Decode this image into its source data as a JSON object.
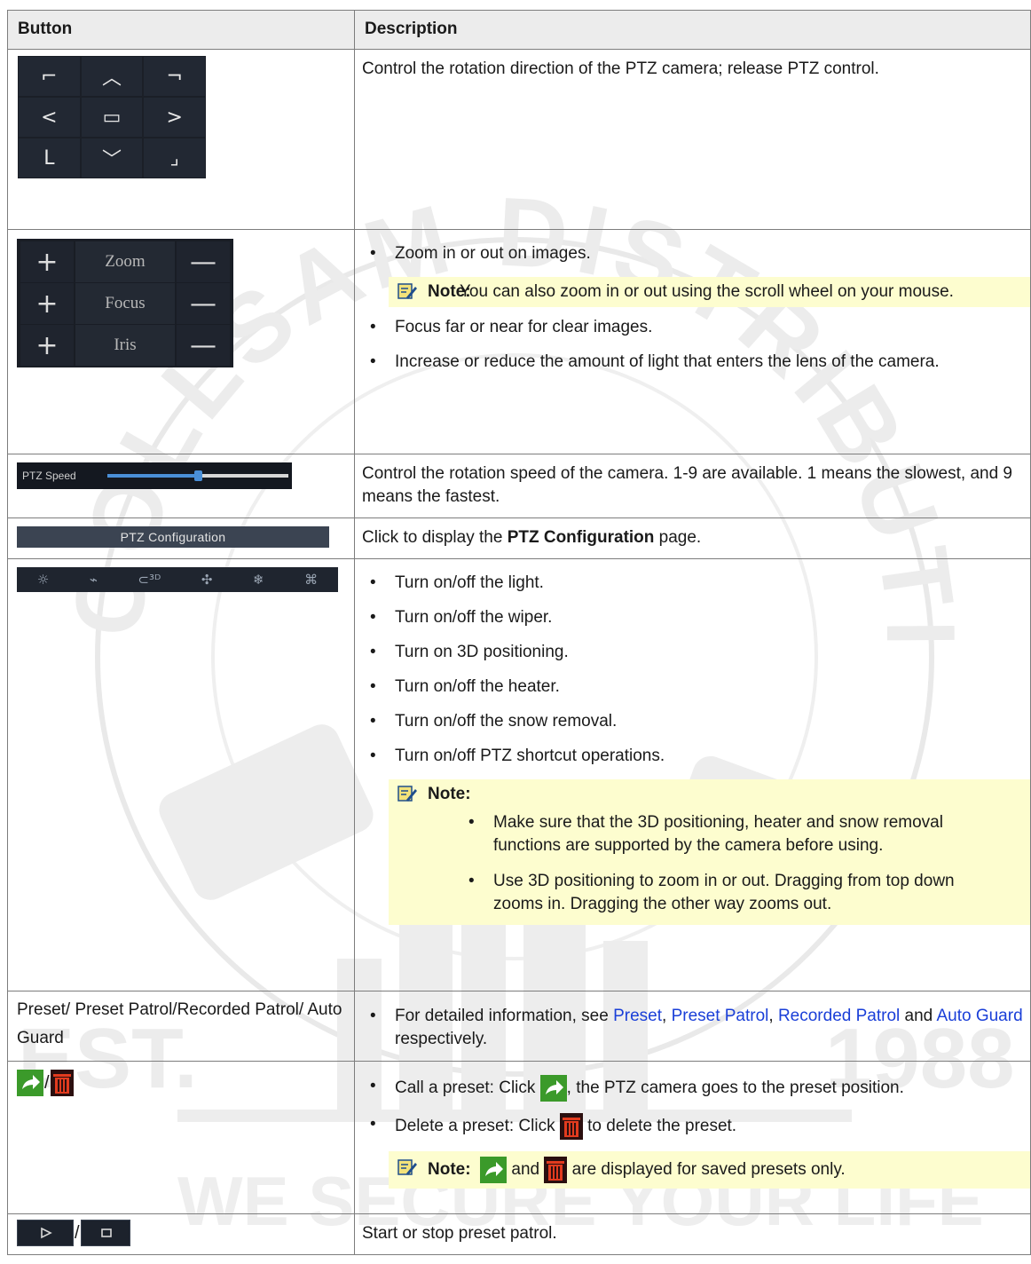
{
  "headers": {
    "button": "Button",
    "description": "Description"
  },
  "colors": {
    "note_bg": "#fdfdcf",
    "link": "#1a3fd8",
    "header_bg": "#ececec"
  },
  "row1": {
    "desc": "Control the rotation direction of the PTZ camera; release PTZ control.",
    "pad": [
      "⌐",
      "︿",
      "¬",
      "<",
      "▭",
      ">",
      "L",
      "﹀",
      "⌟"
    ]
  },
  "row2": {
    "zoom_label": "Zoom",
    "focus_label": "Focus",
    "iris_label": "Iris",
    "plus": "+",
    "minus": "—",
    "bullet1": "Zoom in or out on images.",
    "note_label": "Note:",
    "note_text": "You can also zoom in or out using the scroll wheel on your mouse.",
    "bullet2": "Focus far or near for clear images.",
    "bullet3": "Increase or reduce the amount of light that enters the lens of the camera."
  },
  "row3": {
    "speed_label": "PTZ Speed",
    "speed_level": 0.5,
    "desc": "Control the rotation speed of the camera. 1-9 are available. 1 means the slowest, and 9 means the fastest."
  },
  "row4": {
    "button_label": "PTZ Configuration",
    "desc_pre": "Click to display the ",
    "desc_bold": "PTZ Configuration",
    "desc_post": " page."
  },
  "row5": {
    "icons": [
      "light-icon",
      "wiper-icon",
      "3d-positioning-icon",
      "heater-icon",
      "snow-removal-icon",
      "shortcut-icon"
    ],
    "bullets": [
      "Turn on/off the light.",
      "Turn on/off the wiper.",
      "Turn on 3D positioning.",
      "Turn on/off the heater.",
      "Turn on/off the snow removal.",
      "Turn on/off PTZ shortcut operations."
    ],
    "note_label": "Note:",
    "sub1": "Make sure that the 3D positioning, heater and snow removal functions are supported by the camera before using.",
    "sub2": "Use 3D positioning to zoom in or out. Dragging from top down zooms in. Dragging the other way zooms out."
  },
  "row6": {
    "button_text": "Preset/ Preset Patrol/Recorded Patrol/ Auto Guard",
    "pre": "For detailed information, see ",
    "link1": "Preset",
    "sep1": ", ",
    "link2": "Preset Patrol",
    "sep2": ", ",
    "link3": "Recorded Patrol",
    "and": " and ",
    "link4": "Auto Guard",
    "post": " respectively."
  },
  "row7": {
    "slash": "/",
    "b1_pre": "Call a preset: Click ",
    "b1_post": ", the PTZ camera goes to the preset position.",
    "b2_pre": "Delete a preset: Click ",
    "b2_post": " to delete the preset.",
    "note_label": "Note:",
    "note_and": " and ",
    "note_post": " are displayed for saved presets only."
  },
  "row8": {
    "slash": "/",
    "desc": "Start or stop preset patrol."
  },
  "watermark": {
    "ring_text": "COLLSAM DISTRIBUTION, INC",
    "left_text": "EST.",
    "right_text": "1988",
    "bottom_text": "WE SECURE YOUR LIFE"
  }
}
